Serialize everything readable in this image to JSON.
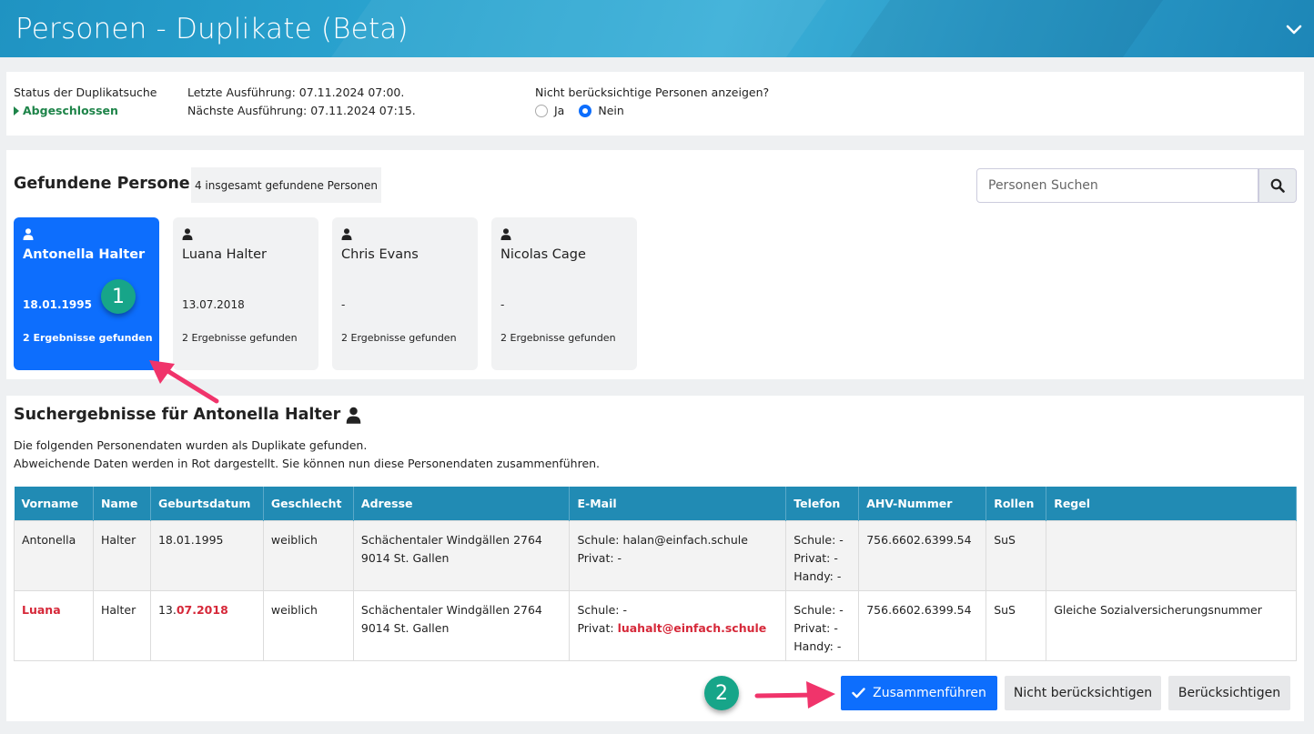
{
  "header": {
    "title": "Personen - Duplikate (Beta)"
  },
  "status": {
    "label": "Status der Duplikatsuche",
    "value": "Abgeschlossen",
    "last_run": "Letzte Ausführung: 07.11.2024 07:00.",
    "next_run": "Nächste Ausführung: 07.11.2024 07:15.",
    "question": "Nicht berücksichtige Personen anzeigen?",
    "option_yes": "Ja",
    "option_no": "Nein",
    "selected": "Nein"
  },
  "found": {
    "title": "Gefundene Personen",
    "count_label": "4 insgesamt gefundene Personen",
    "search_placeholder": "Personen Suchen",
    "cards": [
      {
        "name": "Antonella Halter",
        "date": "18.01.1995",
        "results": "2 Ergebnisse gefunden",
        "active": true
      },
      {
        "name": "Luana Halter",
        "date": "13.07.2018",
        "results": "2 Ergebnisse gefunden",
        "active": false
      },
      {
        "name": "Chris Evans",
        "date": "-",
        "results": "2 Ergebnisse gefunden",
        "active": false
      },
      {
        "name": "Nicolas Cage",
        "date": "-",
        "results": "2 Ergebnisse gefunden",
        "active": false
      }
    ]
  },
  "annotations": {
    "badge1": "1",
    "badge2": "2"
  },
  "results": {
    "title": "Suchergebnisse für Antonella Halter",
    "desc1": "Die folgenden Personendaten wurden als Duplikate gefunden.",
    "desc2": "Abweichende Daten werden in Rot dargestellt. Sie können nun diese Personendaten zusammenführen.",
    "columns": [
      "Vorname",
      "Name",
      "Geburtsdatum",
      "Geschlecht",
      "Adresse",
      "E-Mail",
      "Telefon",
      "AHV-Nummer",
      "Rollen",
      "Regel"
    ],
    "rows": [
      {
        "vorname": "Antonella",
        "name": "Halter",
        "geburtsdatum": "18.01.1995",
        "geschlecht": "weiblich",
        "adresse1": "Schächentaler Windgällen 2764",
        "adresse2": "9014 St. Gallen",
        "email_schule": "Schule: halan@einfach.schule",
        "email_privat": "Privat: -",
        "tel_schule": "Schule: -",
        "tel_privat": "Privat: -",
        "tel_handy": "Handy: -",
        "ahv": "756.6602.6399.54",
        "rollen": "SuS",
        "regel": ""
      },
      {
        "vorname": "Luana",
        "name": "Halter",
        "geburtsdatum_prefix": "13.",
        "geburtsdatum_diff": "07.2018",
        "geschlecht": "weiblich",
        "adresse1": "Schächentaler Windgällen 2764",
        "adresse2": "9014 St. Gallen",
        "email_schule": "Schule: -",
        "email_privat_prefix": "Privat:",
        "email_privat_diff": "luahalt@einfach.schule",
        "tel_schule": "Schule: -",
        "tel_privat": "Privat: -",
        "tel_handy": "Handy: -",
        "ahv": "756.6602.6399.54",
        "rollen": "SuS",
        "regel": "Gleiche Sozialversicherungsnummer"
      }
    ],
    "buttons": {
      "merge": "Zusammenführen",
      "ignore": "Nicht berücksichtigen",
      "consider": "Berücksichtigen"
    }
  },
  "colors": {
    "header": "#2aa3cf",
    "primary": "#0d6efd",
    "table_header": "#218bb4",
    "diff": "#d62839",
    "badge": "#17a589",
    "arrow": "#f0346b"
  }
}
